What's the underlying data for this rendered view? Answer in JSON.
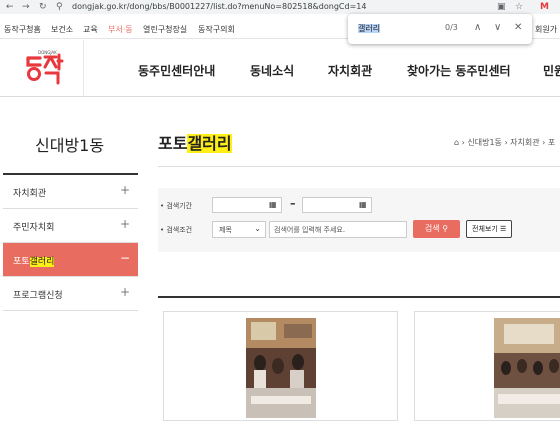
{
  "browser": {
    "url": "dongjak.go.kr/dong/bbs/B0001227/list.do?menuNo=802518&dongCd=14",
    "profile_letter": "M"
  },
  "find_bar": {
    "query": "갤러리",
    "count": "0/3"
  },
  "site_links": [
    "동작구청홈",
    "보건소",
    "교육",
    "부서·동",
    "열린구청장실",
    "동작구의회"
  ],
  "site_link_right": "회원가",
  "logo": {
    "text": "동작",
    "sub": "DONGJAK"
  },
  "gnb": [
    "동주민센터안내",
    "동네소식",
    "자치회관",
    "찾아가는 동주민센터",
    "민원"
  ],
  "sidebar": {
    "title": "신대방1동",
    "items": [
      {
        "label": "자치회관",
        "icon": "+"
      },
      {
        "label": "주민자치회",
        "icon": "+"
      },
      {
        "label_pre": "포토",
        "label_hl": "갤러리",
        "icon": "−"
      },
      {
        "label": "프로그램신청",
        "icon": "+"
      }
    ]
  },
  "main": {
    "title_pre": "포토",
    "title_hl": "갤러리",
    "breadcrumb": "› 신대방1동 › 자치회관 › 포",
    "search": {
      "period_label": "• 검색기간",
      "cond_label": "• 검색조건",
      "select_value": "제목",
      "keyword_placeholder": "검색어를 입력해 주세요.",
      "search_btn": "검색",
      "view_all_btn": "전체보기"
    }
  },
  "colors": {
    "accent": "#e86c5f",
    "highlight": "#ffef16",
    "logo_red": "#e8383d"
  }
}
